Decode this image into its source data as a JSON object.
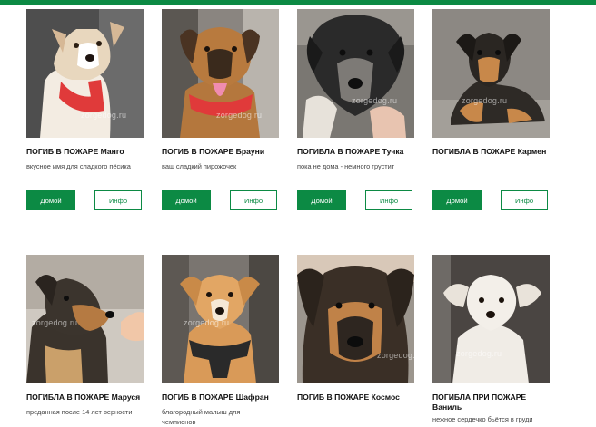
{
  "colors": {
    "accent": "#0c8a44"
  },
  "watermark": "zorgedog.ru",
  "cards": [
    {
      "title": "ПОГИБ В ПОЖАРЕ Манго",
      "desc": "вкусное имя для сладкого пёсика",
      "home": "Домой",
      "info": "Инфо"
    },
    {
      "title": "ПОГИБ В ПОЖАРЕ Брауни",
      "desc": "ваш сладкий пирожочек",
      "home": "Домой",
      "info": "Инфо"
    },
    {
      "title": "ПОГИБЛА В ПОЖАРЕ Тучка",
      "desc": "пока не дома - немного грустит",
      "home": "Домой",
      "info": "Инфо"
    },
    {
      "title": "ПОГИБЛА В ПОЖАРЕ Кармен",
      "desc": "",
      "home": "Домой",
      "info": "Инфо"
    },
    {
      "title": "ПОГИБЛА В ПОЖАРЕ Маруся",
      "desc": "преданная после 14 лет верности"
    },
    {
      "title": "ПОГИБ В ПОЖАРЕ Шафран",
      "desc": "благородный малыш для чемпионов"
    },
    {
      "title": "ПОГИБ В ПОЖАРЕ Космос",
      "desc": ""
    },
    {
      "title": "ПОГИБЛА ПРИ ПОЖАРЕ Ваниль",
      "desc": "нежное сердечко бьётся в груди"
    }
  ]
}
